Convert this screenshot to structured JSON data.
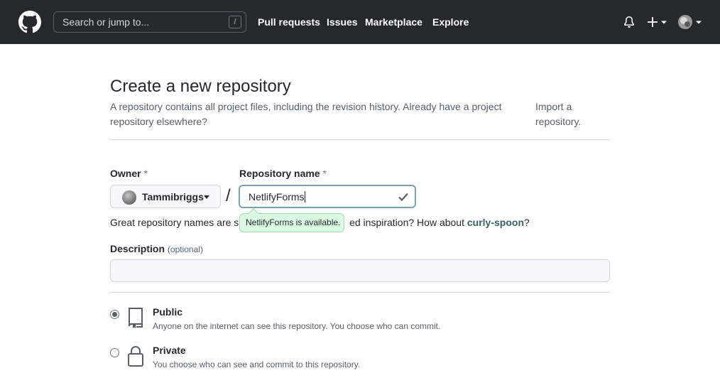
{
  "header": {
    "search_placeholder": "Search or jump to...",
    "search_shortcut": "/",
    "nav": [
      "Pull requests",
      "Issues",
      "Marketplace",
      "Explore"
    ]
  },
  "page": {
    "title": "Create a new repository",
    "subtitle": "A repository contains all project files, including the revision history. Already have a project repository elsewhere?",
    "import_link": "Import a repository."
  },
  "form": {
    "owner_label": "Owner",
    "required_mark": "*",
    "owner_name": "Tammibriggs",
    "path_separator": "/",
    "repo_label": "Repository name",
    "repo_value": "NetlifyForms",
    "availability_tooltip": "NetlifyForms is available.",
    "hint_prefix": "Great repository names are sh",
    "hint_middle": "ed inspiration? How about",
    "hint_suggestion": "curly-spoon",
    "hint_suffix": "?",
    "description_label": "Description",
    "description_optional": "(optional)",
    "description_value": ""
  },
  "visibility": {
    "selected": "public",
    "public_title": "Public",
    "public_desc": "Anyone on the internet can see this repository. You choose who can commit.",
    "private_title": "Private",
    "private_desc": "You choose who can see and commit to this repository."
  }
}
